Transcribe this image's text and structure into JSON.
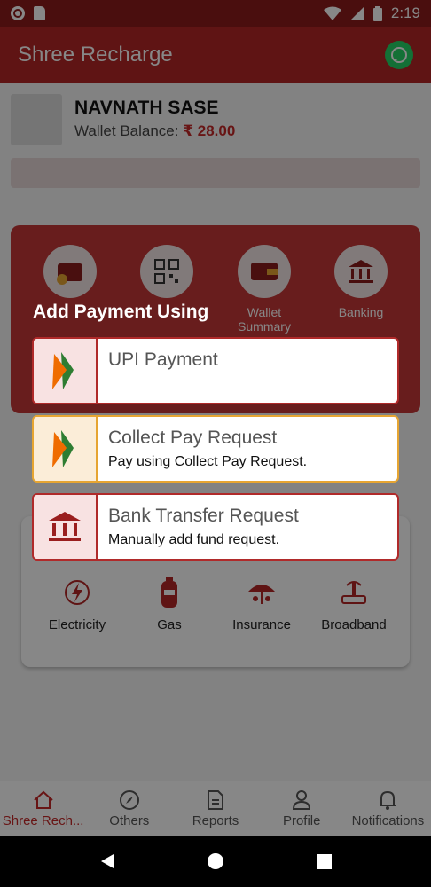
{
  "status": {
    "time": "2:19"
  },
  "app": {
    "title": "Shree Recharge"
  },
  "profile": {
    "name": "NAVNATH SASE",
    "wallet_label": "Wallet Balance:",
    "wallet_amount": "₹ 28.00"
  },
  "quick": [
    {
      "label": "",
      "icon": "wallet-add-icon"
    },
    {
      "label": "",
      "icon": "qr-code-icon"
    },
    {
      "label": "Wallet Summary",
      "icon": "wallet-icon"
    },
    {
      "label": "Banking",
      "icon": "bank-icon"
    }
  ],
  "bills": [
    {
      "label": "Electricity",
      "icon": "electricity-icon"
    },
    {
      "label": "Gas",
      "icon": "gas-cylinder-icon"
    },
    {
      "label": "Insurance",
      "icon": "insurance-umbrella-icon"
    },
    {
      "label": "Broadband",
      "icon": "router-icon"
    }
  ],
  "nav": [
    {
      "label": "Shree Rech...",
      "icon": "home-icon"
    },
    {
      "label": "Others",
      "icon": "compass-icon"
    },
    {
      "label": "Reports",
      "icon": "document-icon"
    },
    {
      "label": "Profile",
      "icon": "user-icon"
    },
    {
      "label": "Notifications",
      "icon": "bell-icon"
    }
  ],
  "dialog": {
    "title": "Add Payment Using",
    "options": [
      {
        "title": "UPI Payment",
        "subtitle": "",
        "icon": "upi-logo-icon"
      },
      {
        "title": "Collect Pay Request",
        "subtitle": "Pay using Collect Pay Request.",
        "icon": "upi-logo-icon"
      },
      {
        "title": "Bank Transfer Request",
        "subtitle": "Manually add fund request.",
        "icon": "bank-icon"
      }
    ]
  },
  "colors": {
    "primary": "#b32626",
    "accent": "#c42828",
    "collect_border": "#e6a532"
  }
}
